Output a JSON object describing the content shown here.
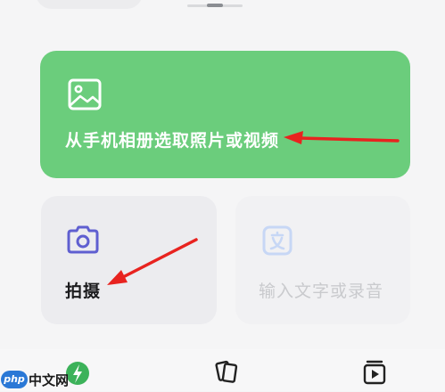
{
  "actions": {
    "pick_media_label": "从手机相册选取照片或视频",
    "camera_label": "拍摄",
    "text_input_label": "输入文字或录音"
  },
  "watermark": {
    "logo_text": "php",
    "site_text": "中文网"
  },
  "colors": {
    "pick_card": "#6bcd7c",
    "camera_icon": "#5f5fd0",
    "annotation_arrow": "#e8231f"
  },
  "icons": {
    "pick_media": "image-icon",
    "camera": "camera-icon",
    "text_input": "text-icon",
    "tab_1": "app-logo-icon",
    "tab_2": "cards-icon",
    "tab_3": "video-play-icon"
  }
}
